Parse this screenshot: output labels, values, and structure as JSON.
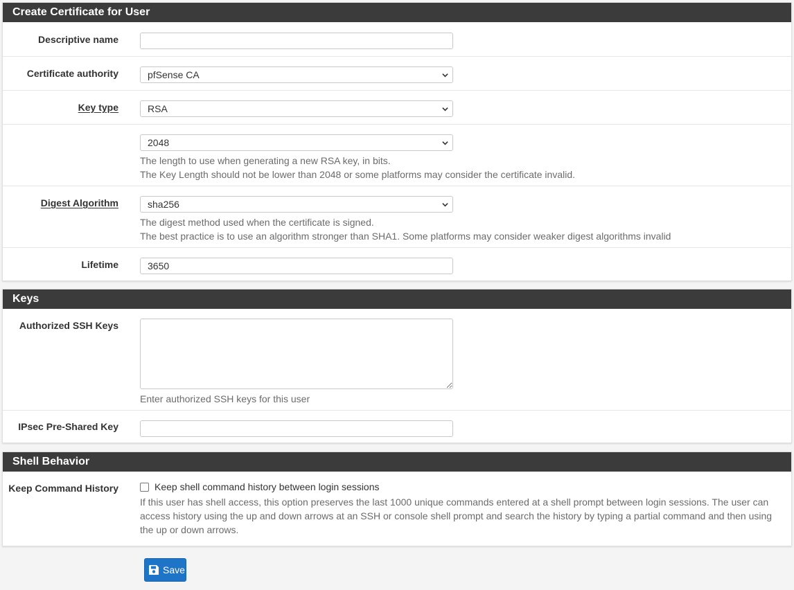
{
  "certificate_panel": {
    "title": "Create Certificate for User",
    "descriptive_name": {
      "label": "Descriptive name",
      "value": ""
    },
    "certificate_authority": {
      "label": "Certificate authority",
      "value": "pfSense CA"
    },
    "key_type": {
      "label": "Key type",
      "value": "RSA"
    },
    "key_length": {
      "value": "2048",
      "help_line1": "The length to use when generating a new RSA key, in bits.",
      "help_line2": "The Key Length should not be lower than 2048 or some platforms may consider the certificate invalid."
    },
    "digest_algorithm": {
      "label": "Digest Algorithm",
      "value": "sha256",
      "help_line1": "The digest method used when the certificate is signed.",
      "help_line2": "The best practice is to use an algorithm stronger than SHA1. Some platforms may consider weaker digest algorithms invalid"
    },
    "lifetime": {
      "label": "Lifetime",
      "value": "3650"
    }
  },
  "keys_panel": {
    "title": "Keys",
    "ssh_keys": {
      "label": "Authorized SSH Keys",
      "value": "",
      "help": "Enter authorized SSH keys for this user"
    },
    "ipsec_psk": {
      "label": "IPsec Pre-Shared Key",
      "value": ""
    }
  },
  "shell_panel": {
    "title": "Shell Behavior",
    "keep_history": {
      "label": "Keep Command History",
      "checkbox_label": "Keep shell command history between login sessions",
      "checked": false,
      "help": "If this user has shell access, this option preserves the last 1000 unique commands entered at a shell prompt between login sessions. The user can access history using the up and down arrows at an SSH or console shell prompt and search the history by typing a partial command and then using the up or down arrows."
    }
  },
  "actions": {
    "save_label": "Save",
    "save_icon": "floppy-disk-icon"
  },
  "colors": {
    "panel_heading": "#3b3b3b",
    "primary_button": "#1e74c7"
  }
}
